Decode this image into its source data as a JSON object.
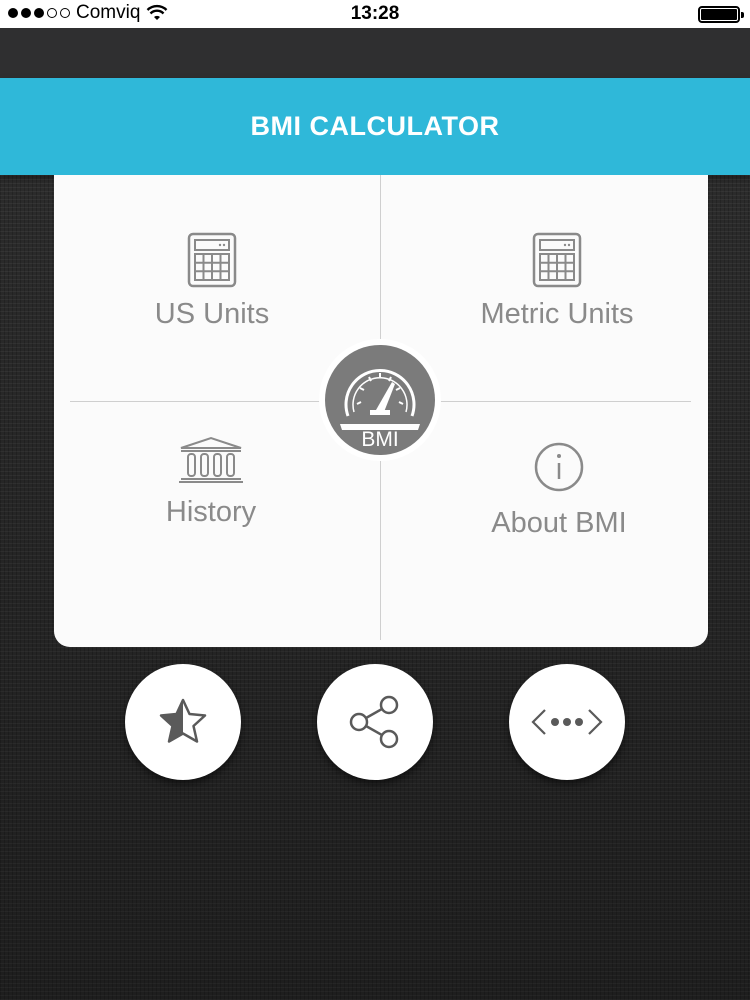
{
  "status_bar": {
    "carrier": "Comviq",
    "time": "13:28",
    "signal_bars_filled": 3,
    "signal_bars_total": 5
  },
  "header": {
    "title": "BMI CALCULATOR"
  },
  "menu": {
    "us_units": "US Units",
    "metric_units": "Metric Units",
    "history": "History",
    "about": "About BMI",
    "center_badge": "BMI"
  },
  "actions": [
    {
      "icon": "star-half-icon"
    },
    {
      "icon": "share-icon"
    },
    {
      "icon": "more-dots-icon"
    }
  ],
  "colors": {
    "accent": "#2fb8d9",
    "card": "#fbfbfb",
    "label": "#8a8a8a",
    "badge": "#7b7b7b"
  }
}
